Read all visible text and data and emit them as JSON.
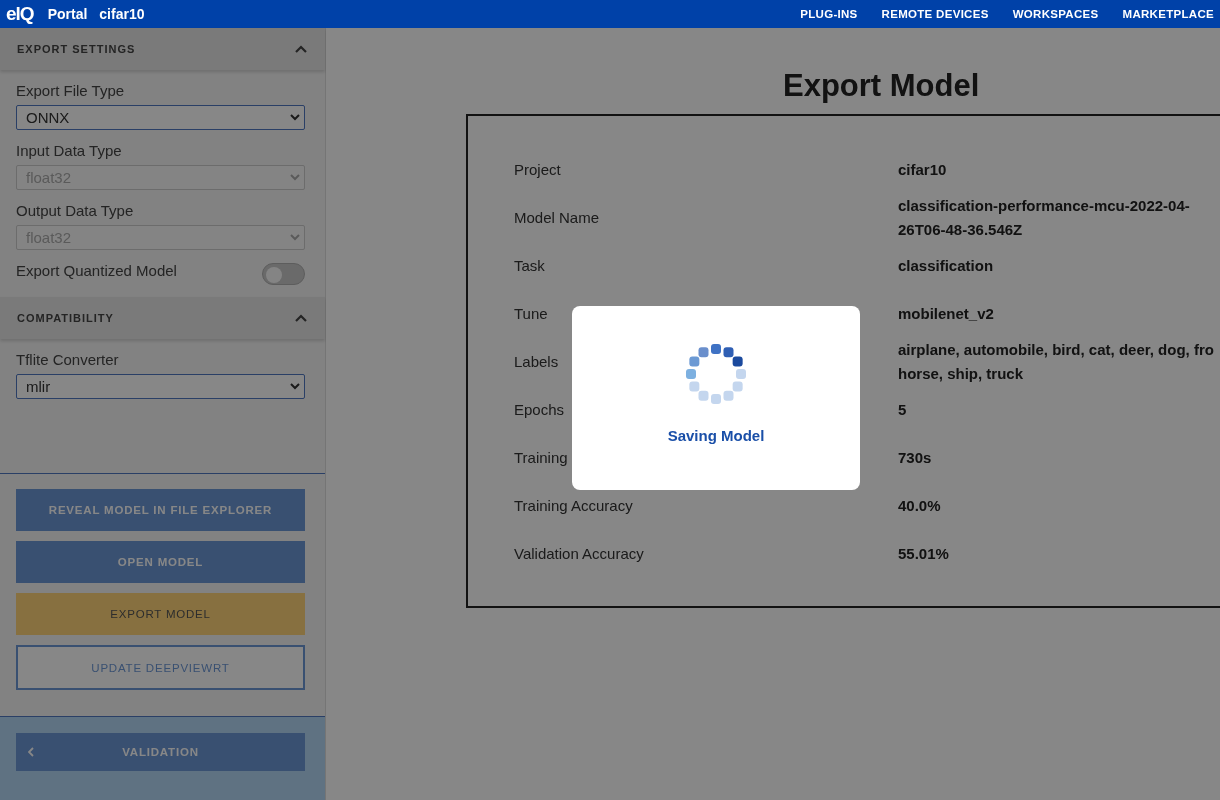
{
  "header": {
    "logo": "elQ",
    "app": "Portal",
    "project": "cifar10",
    "nav": [
      "PLUG-INS",
      "REMOTE DEVICES",
      "WORKSPACES",
      "MARKETPLACE"
    ]
  },
  "sidebar": {
    "sections": [
      {
        "title": "EXPORT SETTINGS",
        "expanded": true,
        "fields": [
          {
            "kind": "select",
            "label": "Export File Type",
            "value": "ONNX",
            "disabled": false
          },
          {
            "kind": "select",
            "label": "Input Data Type",
            "value": "float32",
            "disabled": true
          },
          {
            "kind": "select",
            "label": "Output Data Type",
            "value": "float32",
            "disabled": true
          },
          {
            "kind": "toggle",
            "label": "Export Quantized Model",
            "on": false
          }
        ]
      },
      {
        "title": "COMPATIBILITY",
        "expanded": true,
        "fields": [
          {
            "kind": "select",
            "label": "Tflite Converter",
            "value": "mlir",
            "disabled": false
          }
        ]
      }
    ],
    "buttons": [
      {
        "kind": "primary",
        "label": "REVEAL MODEL IN FILE EXPLORER"
      },
      {
        "kind": "primary",
        "label": "OPEN MODEL"
      },
      {
        "kind": "accent",
        "label": "EXPORT MODEL"
      },
      {
        "kind": "outline",
        "label": "UPDATE DEEPVIEWRT"
      }
    ],
    "back_button": "VALIDATION"
  },
  "main": {
    "title": "Export Model",
    "details": [
      {
        "label": "Project",
        "value": [
          "cifar10"
        ]
      },
      {
        "label": "Model Name",
        "value": [
          "classification-performance-mcu-2022-04-",
          "26T06-48-36.546Z"
        ]
      },
      {
        "label": "Task",
        "value": [
          "classification"
        ]
      },
      {
        "label": "Tune",
        "value": [
          "mobilenet_v2"
        ]
      },
      {
        "label": "Labels",
        "value": [
          "airplane, automobile, bird, cat, deer, dog, fro",
          "horse, ship, truck"
        ]
      },
      {
        "label": "Epochs",
        "value": [
          "5"
        ]
      },
      {
        "label": "Training",
        "value": [
          "730s"
        ]
      },
      {
        "label": "Training Accuracy",
        "value": [
          "40.0%"
        ]
      },
      {
        "label": "Validation Accuracy",
        "value": [
          "55.01%"
        ]
      }
    ]
  },
  "modal": {
    "message": "Saving Model"
  }
}
